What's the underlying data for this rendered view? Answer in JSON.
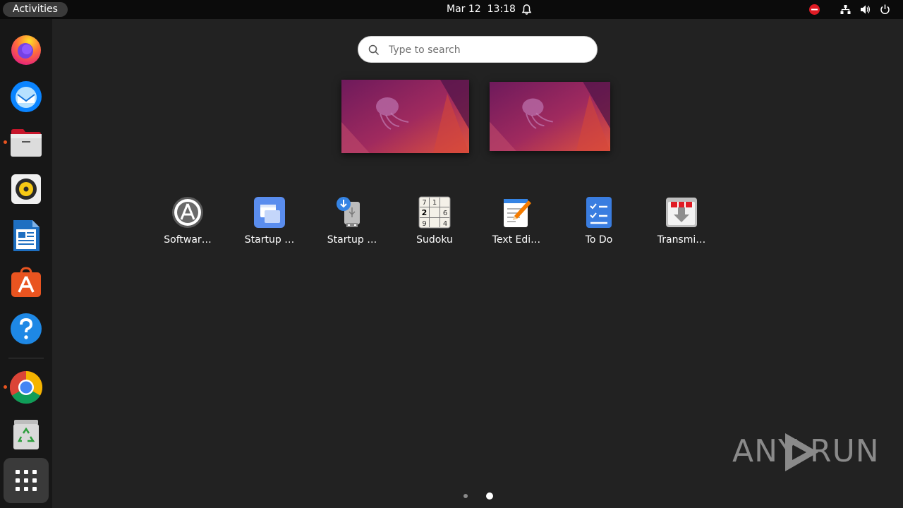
{
  "topbar": {
    "activities_label": "Activities",
    "date": "Mar 12",
    "time": "13:18",
    "icons": [
      "bell-icon",
      "do-not-disturb-icon",
      "network-icon",
      "volume-icon",
      "power-icon"
    ]
  },
  "dock": {
    "items": [
      {
        "name": "firefox",
        "running": false
      },
      {
        "name": "thunderbird",
        "running": false
      },
      {
        "name": "files",
        "running": true
      },
      {
        "name": "rhythmbox",
        "running": false
      },
      {
        "name": "libreoffice-writer",
        "running": false
      },
      {
        "name": "ubuntu-software",
        "running": false
      },
      {
        "name": "help",
        "running": false
      },
      {
        "name": "google-chrome",
        "running": true
      },
      {
        "name": "trash",
        "running": false
      }
    ],
    "show_apps": "show-applications-icon"
  },
  "search": {
    "placeholder": "Type to search"
  },
  "workspaces": [
    {
      "index": 1
    },
    {
      "index": 2
    }
  ],
  "apps": [
    {
      "label": "Softwar…",
      "icon": "software-updater-icon"
    },
    {
      "label": "Startup …",
      "icon": "startup-applications-icon"
    },
    {
      "label": "Startup …",
      "icon": "startup-disk-creator-icon"
    },
    {
      "label": "Sudoku",
      "icon": "sudoku-icon"
    },
    {
      "label": "Text Edi…",
      "icon": "text-editor-icon"
    },
    {
      "label": "To Do",
      "icon": "todo-icon"
    },
    {
      "label": "Transmi…",
      "icon": "transmission-icon"
    }
  ],
  "pagination": {
    "pages": 2,
    "current": 2
  },
  "watermark": {
    "text_left": "ANY",
    "text_right": "RUN"
  },
  "colors": {
    "accent": "#e95420",
    "background": "#222222",
    "topbar": "#0b0b0b",
    "dock": "#171717"
  }
}
